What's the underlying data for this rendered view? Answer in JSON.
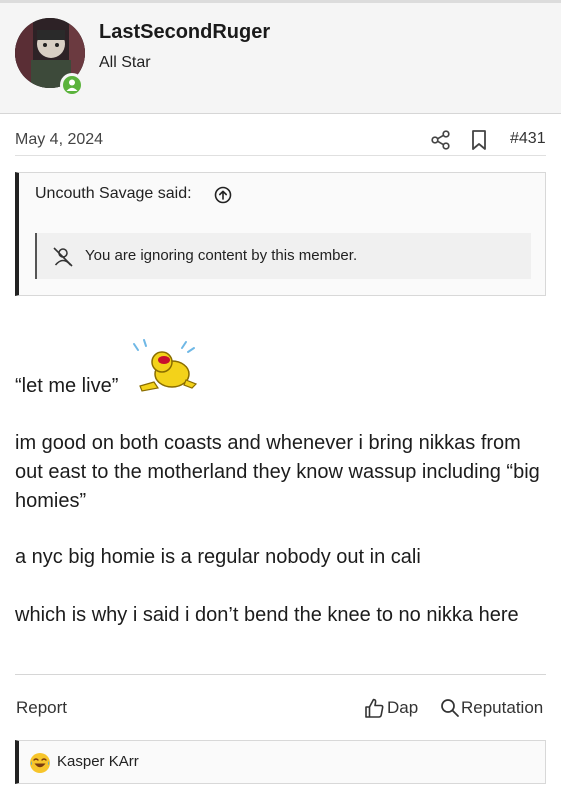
{
  "user": {
    "name": "LastSecondRuger",
    "title": "All Star",
    "status_color": "#5bb33c"
  },
  "post": {
    "date": "May 4, 2024",
    "number": "#431",
    "quote": {
      "author_said": "Uncouth Savage said:",
      "ignored_text": "You are ignoring content by this member."
    },
    "paragraphs": [
      "“let me live”",
      "im good on both coasts and whenever i bring nikkas from out east to the motherland they know wassup including “big homies”",
      "a nyc big homie is a regular nobody out in cali",
      "which is why i said i don’t bend the knee to no nikka here"
    ]
  },
  "actions": {
    "report": "Report",
    "dap": "Dap",
    "reputation": "Reputation"
  },
  "reactions": {
    "users": "Kasper KArr"
  },
  "icons": [
    "share-icon",
    "bookmark-icon",
    "arrow-up-circle-icon",
    "muted-user-icon",
    "laughing-emoji-icon",
    "thumbs-up-icon",
    "search-icon",
    "laugh-reaction-icon"
  ]
}
